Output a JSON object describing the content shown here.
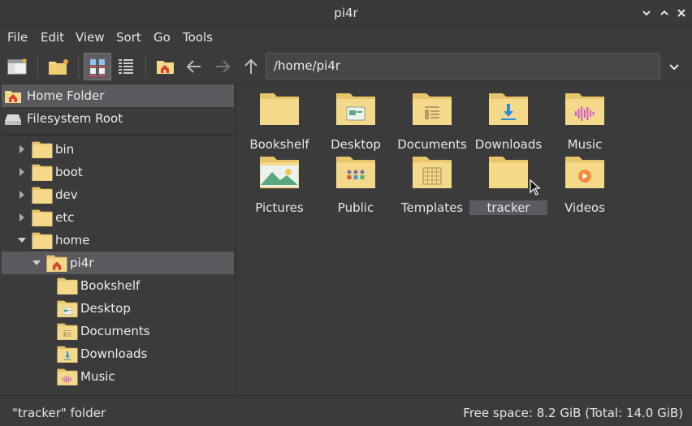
{
  "window": {
    "title": "pi4r"
  },
  "menubar": {
    "items": [
      "File",
      "Edit",
      "View",
      "Sort",
      "Go",
      "Tools"
    ]
  },
  "toolbar": {
    "path_value": "/home/pi4r"
  },
  "sidebar": {
    "places": [
      {
        "label": "Home Folder",
        "icon": "home-folder-icon",
        "selected": true
      },
      {
        "label": "Filesystem Root",
        "icon": "drive-icon",
        "selected": false
      }
    ],
    "tree": [
      {
        "label": "bin",
        "depth": 0,
        "expander": "collapsed",
        "icon": "folder"
      },
      {
        "label": "boot",
        "depth": 0,
        "expander": "collapsed",
        "icon": "folder"
      },
      {
        "label": "dev",
        "depth": 0,
        "expander": "collapsed",
        "icon": "folder"
      },
      {
        "label": "etc",
        "depth": 0,
        "expander": "collapsed",
        "icon": "folder"
      },
      {
        "label": "home",
        "depth": 0,
        "expander": "expanded",
        "icon": "folder"
      },
      {
        "label": "pi4r",
        "depth": 1,
        "expander": "expanded",
        "icon": "home-folder",
        "selected": true
      },
      {
        "label": "Bookshelf",
        "depth": 2,
        "expander": "none",
        "icon": "folder"
      },
      {
        "label": "Desktop",
        "depth": 2,
        "expander": "none",
        "icon": "desktop-folder"
      },
      {
        "label": "Documents",
        "depth": 2,
        "expander": "none",
        "icon": "documents-folder"
      },
      {
        "label": "Downloads",
        "depth": 2,
        "expander": "none",
        "icon": "downloads-folder"
      },
      {
        "label": "Music",
        "depth": 2,
        "expander": "none",
        "icon": "music-folder"
      }
    ]
  },
  "content": {
    "items": [
      {
        "label": "Bookshelf",
        "icon": "folder"
      },
      {
        "label": "Desktop",
        "icon": "desktop-folder"
      },
      {
        "label": "Documents",
        "icon": "documents-folder"
      },
      {
        "label": "Downloads",
        "icon": "downloads-folder"
      },
      {
        "label": "Music",
        "icon": "music-folder"
      },
      {
        "label": "Pictures",
        "icon": "pictures-folder"
      },
      {
        "label": "Public",
        "icon": "public-folder"
      },
      {
        "label": "Templates",
        "icon": "templates-folder"
      },
      {
        "label": "tracker",
        "icon": "folder",
        "selected": true
      },
      {
        "label": "Videos",
        "icon": "videos-folder"
      }
    ]
  },
  "statusbar": {
    "left": "\"tracker\" folder",
    "right": "Free space: 8.2 GiB (Total: 14.0 GiB)"
  },
  "colors": {
    "folder": "#f5d98b",
    "folder_tab": "#e8c56a",
    "selection": "#5a5a5e",
    "background": "#3b3b3b"
  }
}
